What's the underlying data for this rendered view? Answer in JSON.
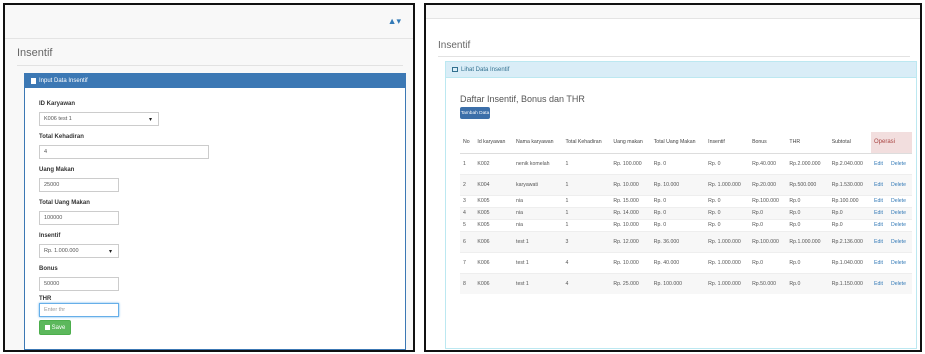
{
  "left": {
    "user_menu": "▲▾",
    "page_title": "Insentif",
    "card_title": "Input Data Insentif",
    "fields": {
      "id_karyawan_label": "ID Karyawan",
      "id_karyawan_value": "K006 test 1",
      "total_kehadiran_label": "Total Kehadiran",
      "total_kehadiran_value": "4",
      "uang_makan_label": "Uang Makan",
      "uang_makan_value": "25000",
      "total_uang_makan_label": "Total Uang Makan",
      "total_uang_makan_value": "100000",
      "insentif_label": "Insentif",
      "insentif_value": "Rp. 1.000.000",
      "bonus_label": "Bonus",
      "bonus_value": "50000",
      "thr_label": "THR",
      "thr_placeholder": "Enter thr"
    },
    "save_label": "Save"
  },
  "right": {
    "page_title": "Insentif",
    "card_title": "Lihat Data Insentif",
    "list_title": "Daftar Insentif, Bonus dan THR",
    "add_label": "Tambah Data",
    "columns": [
      "No",
      "Id karyawan",
      "Nama karyawan",
      "Total Kehadiran",
      "Uang makan",
      "Total Uang Makan",
      "Insentif",
      "Bonus",
      "THR",
      "Subtotal",
      "Operasi"
    ],
    "edit_label": "Edit",
    "delete_label": "Delete",
    "rows": [
      {
        "no": "1",
        "id": "K002",
        "nama": "nenik komelah",
        "hadir": "1",
        "uang": "Rp. 100.000",
        "total_uang": "Rp. 0",
        "insentif": "Rp. 0",
        "bonus": "Rp.40.000",
        "thr": "Rp.2.000.000",
        "subtotal": "Rp.2.040.000",
        "edit": "Edit",
        "delete": "Delete"
      },
      {
        "no": "2",
        "id": "K004",
        "nama": "karyawati",
        "hadir": "1",
        "uang": "Rp. 10.000",
        "total_uang": "Rp. 10.000",
        "insentif": "Rp. 1.000.000",
        "bonus": "Rp.20.000",
        "thr": "Rp.500.000",
        "subtotal": "Rp.1.530.000",
        "edit": "Edit",
        "delete": "Delete"
      },
      {
        "no": "3",
        "id": "K005",
        "nama": "nia",
        "hadir": "1",
        "uang": "Rp. 15.000",
        "total_uang": "Rp. 0",
        "insentif": "Rp. 0",
        "bonus": "Rp.100.000",
        "thr": "Rp.0",
        "subtotal": "Rp.100.000",
        "edit": "Edit",
        "delete": "Delete"
      },
      {
        "no": "4",
        "id": "K005",
        "nama": "nia",
        "hadir": "1",
        "uang": "Rp. 14.000",
        "total_uang": "Rp. 0",
        "insentif": "Rp. 0",
        "bonus": "Rp.0",
        "thr": "Rp.0",
        "subtotal": "Rp.0",
        "edit": "Edit",
        "delete": "Delete"
      },
      {
        "no": "5",
        "id": "K005",
        "nama": "nia",
        "hadir": "1",
        "uang": "Rp. 10.000",
        "total_uang": "Rp. 0",
        "insentif": "Rp. 0",
        "bonus": "Rp.0",
        "thr": "Rp.0",
        "subtotal": "Rp.0",
        "edit": "Edit",
        "delete": "Delete"
      },
      {
        "no": "6",
        "id": "K006",
        "nama": "test 1",
        "hadir": "3",
        "uang": "Rp. 12.000",
        "total_uang": "Rp. 36.000",
        "insentif": "Rp. 1.000.000",
        "bonus": "Rp.100.000",
        "thr": "Rp.1.000.000",
        "subtotal": "Rp.2.136.000",
        "edit": "Edit",
        "delete": "Delete"
      },
      {
        "no": "7",
        "id": "K006",
        "nama": "test 1",
        "hadir": "4",
        "uang": "Rp. 10.000",
        "total_uang": "Rp. 40.000",
        "insentif": "Rp. 1.000.000",
        "bonus": "Rp.0",
        "thr": "Rp.0",
        "subtotal": "Rp.1.040.000",
        "edit": "Edit",
        "delete": "Delete"
      },
      {
        "no": "8",
        "id": "K006",
        "nama": "test 1",
        "hadir": "4",
        "uang": "Rp. 25.000",
        "total_uang": "Rp. 100.000",
        "insentif": "Rp. 1.000.000",
        "bonus": "Rp.50.000",
        "thr": "Rp.0",
        "subtotal": "Rp.1.150.000",
        "edit": "Edit",
        "delete": "Delete"
      }
    ]
  },
  "colors": {
    "primary": "#3c78b4",
    "success": "#5cb85c",
    "info_bg": "#d9edf7",
    "danger_bg": "#f2dede"
  }
}
